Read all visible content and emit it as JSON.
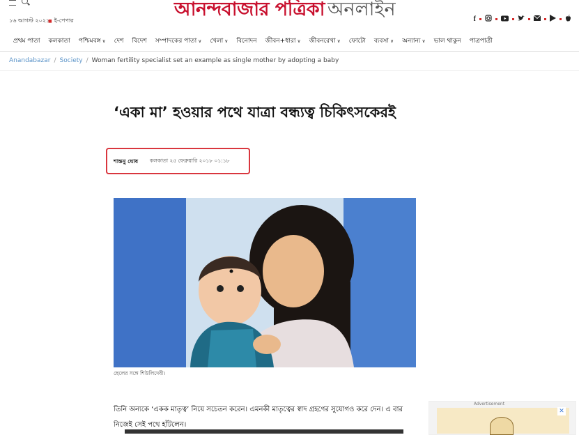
{
  "header": {
    "date": "১৬ আগস্ট ২০২১",
    "epaper": "ই-পেপার",
    "logo_red": "আনন্দবাজার পত্রিকা",
    "logo_gray": "অনলাইন",
    "social_icons": [
      "facebook-icon",
      "instagram-icon",
      "youtube-icon",
      "twitter-icon",
      "mail-icon",
      "play-store-icon",
      "apple-icon"
    ]
  },
  "nav": {
    "items": [
      {
        "label": "প্রথম পাতা",
        "dropdown": false
      },
      {
        "label": "কলকাতা",
        "dropdown": false
      },
      {
        "label": "পশ্চিমবঙ্গ",
        "dropdown": true
      },
      {
        "label": "দেশ",
        "dropdown": false
      },
      {
        "label": "বিদেশ",
        "dropdown": false
      },
      {
        "label": "সম্পাদকের পাতা",
        "dropdown": true
      },
      {
        "label": "খেলা",
        "dropdown": true
      },
      {
        "label": "বিনোদন",
        "dropdown": false
      },
      {
        "label": "জীবন+ধারা",
        "dropdown": true
      },
      {
        "label": "জীবনরেখা",
        "dropdown": true
      },
      {
        "label": "ফোটো",
        "dropdown": false
      },
      {
        "label": "ব্যবসা",
        "dropdown": true
      },
      {
        "label": "অন্যান্য",
        "dropdown": true
      },
      {
        "label": "ভাল থাকুন",
        "dropdown": false
      },
      {
        "label": "পাত্রপাত্রী",
        "dropdown": false
      }
    ]
  },
  "breadcrumb": {
    "home": "Anandabazar",
    "section": "Society",
    "current": "Woman fertility specialist set an example as single mother by adopting a baby"
  },
  "article": {
    "headline": "‘একা মা’ হওয়ার পথে যাত্রা বন্ধ্যত্ব চিকিৎসকেরই",
    "author": "শান্তনু ঘোষ",
    "dateline": "কলকাতা ২৫ ফেব্রুয়ারি ২০১৮ ০১:১৮",
    "photo_caption": "ছেলের সঙ্গে শিউলিদেবী।",
    "paragraph": "তিনি অন্যকে ‘একক মাতৃত্ব’ নিয়ে সচেতন করেন। এমনকী মাতৃত্বের স্বাদ গ্রহণের সুযোগও করে দেন। এ বার নিজেই সেই পথে হাঁটলেন।"
  },
  "ad": {
    "label": "Advertisement",
    "close": "✕"
  },
  "colors": {
    "brand_red": "#c8102e",
    "highlight_box": "#d9363e",
    "link_blue": "#5a93c8",
    "photo_bg": "#3f72c6"
  }
}
